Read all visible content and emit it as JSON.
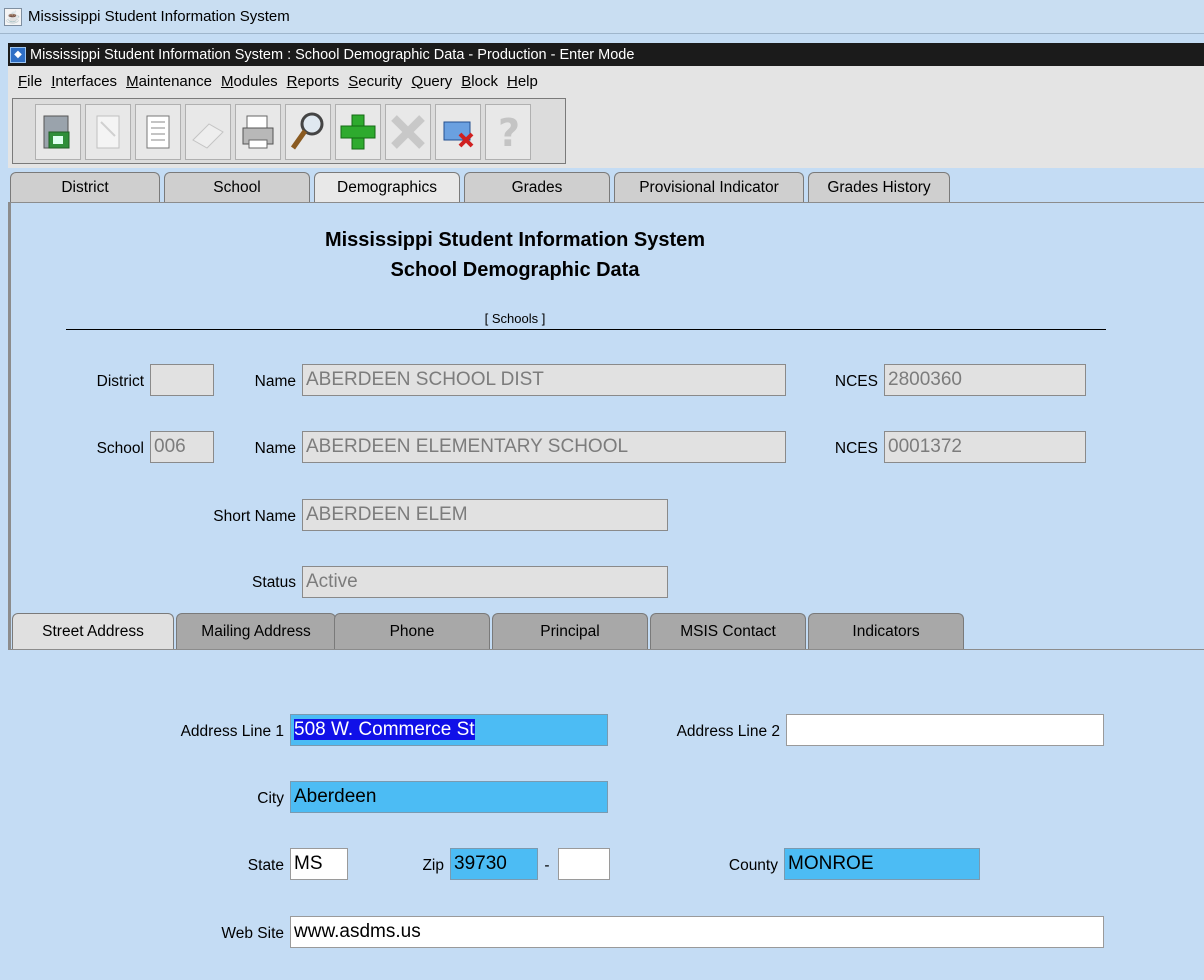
{
  "window": {
    "title": "Mississippi Student Information System"
  },
  "app": {
    "title": "Mississippi Student Information System : School Demographic Data  -  Production  -  Enter Mode"
  },
  "menu": [
    "File",
    "Interfaces",
    "Maintenance",
    "Modules",
    "Reports",
    "Security",
    "Query",
    "Block",
    "Help"
  ],
  "toolbar": {
    "buttons": [
      {
        "name": "save",
        "icon": "save-icon",
        "enabled": true
      },
      {
        "name": "new-record",
        "icon": "note-icon",
        "enabled": false
      },
      {
        "name": "list",
        "icon": "list-icon",
        "enabled": true
      },
      {
        "name": "eraser",
        "icon": "eraser-icon",
        "enabled": false
      },
      {
        "name": "print",
        "icon": "printer-icon",
        "enabled": true
      },
      {
        "name": "search",
        "icon": "magnifier-icon",
        "enabled": true
      },
      {
        "name": "insert",
        "icon": "plus-icon",
        "enabled": true
      },
      {
        "name": "delete",
        "icon": "x-icon",
        "enabled": false
      },
      {
        "name": "exit",
        "icon": "exit-icon",
        "enabled": true
      },
      {
        "name": "help",
        "icon": "help-icon",
        "enabled": false
      }
    ]
  },
  "tabs": [
    "District",
    "School",
    "Demographics",
    "Grades",
    "Provisional Indicator",
    "Grades History"
  ],
  "active_tab": "Demographics",
  "header": {
    "line1": "Mississippi Student Information System",
    "line2": "School Demographic Data",
    "section": "[ Schools ]"
  },
  "fields": {
    "district_label": "District",
    "district_value": "",
    "district_name_label": "Name",
    "district_name": "ABERDEEN SCHOOL DIST",
    "district_nces_label": "NCES",
    "district_nces": "2800360",
    "school_label": "School",
    "school_value": "006",
    "school_name_label": "Name",
    "school_name": "ABERDEEN ELEMENTARY SCHOOL",
    "school_nces_label": "NCES",
    "school_nces": "0001372",
    "short_name_label": "Short Name",
    "short_name": "ABERDEEN ELEM",
    "status_label": "Status",
    "status": "Active"
  },
  "subtabs": [
    "Street Address",
    "Mailing Address",
    "Phone",
    "Principal",
    "MSIS Contact",
    "Indicators"
  ],
  "active_subtab": "Street Address",
  "address": {
    "line1_label": "Address Line 1",
    "line1": "508 W. Commerce St",
    "line2_label": "Address Line 2",
    "line2": "",
    "city_label": "City",
    "city": "Aberdeen",
    "state_label": "State",
    "state": "MS",
    "zip_label": "Zip",
    "zip": "39730",
    "zip_sep": "-",
    "zip_ext": "",
    "county_label": "County",
    "county": "MONROE",
    "website_label": "Web Site",
    "website": "www.asdms.us"
  },
  "colors": {
    "panel_bg": "#c4dcf4",
    "required_field": "#4cbcf4",
    "selection": "#1010e8"
  }
}
